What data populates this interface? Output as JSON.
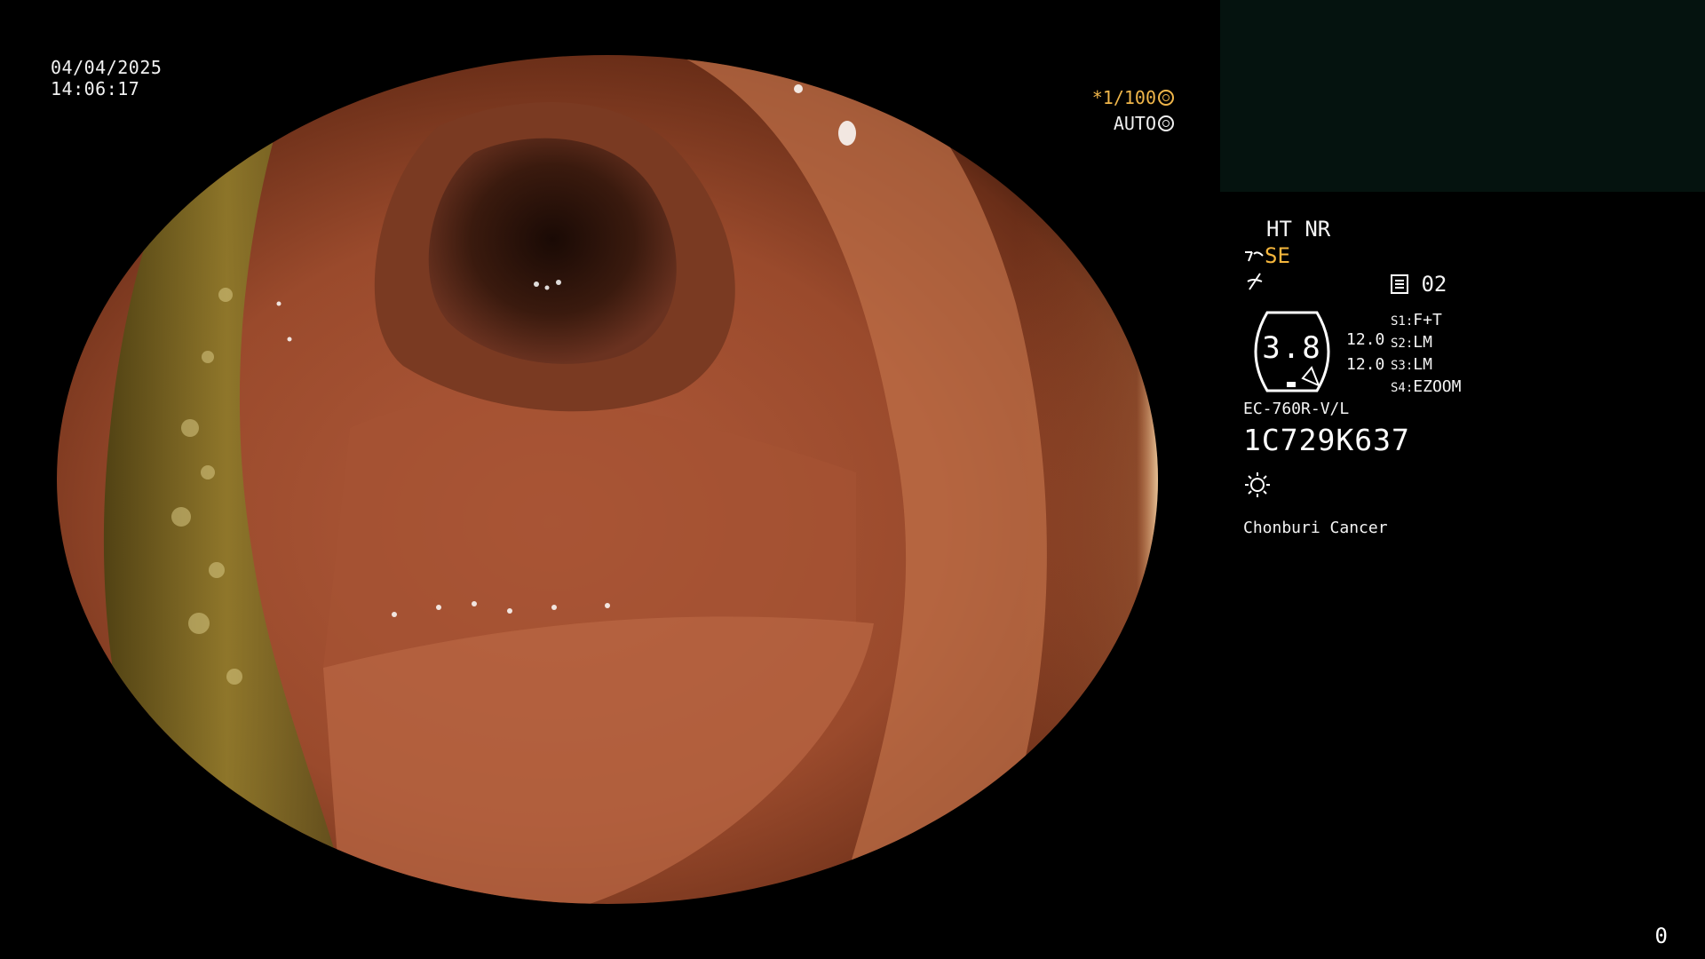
{
  "datetime": {
    "date": "04/04/2025",
    "time": "14:06:17"
  },
  "shutter": {
    "text": "*1/100",
    "icon": "shutter-icon",
    "color": "#f0b64a"
  },
  "iris": {
    "text": "AUTO",
    "icon": "iris-icon"
  },
  "panel": {
    "enhance": "HT NR",
    "structure_mode": "SE",
    "structure_icon": "structure-enhancement-icon",
    "color_icon": "color-mode-icon",
    "memory_icon": "memory-card-icon",
    "memory_count": "02",
    "gauge_value": "3.8",
    "gauge_left_top": "12.0",
    "gauge_left_bottom": "12.0",
    "switches": [
      {
        "key": "S1:",
        "value": "F+T"
      },
      {
        "key": "S2:",
        "value": "LM"
      },
      {
        "key": "S3:",
        "value": "LM"
      },
      {
        "key": "S4:",
        "value": "EZOOM"
      }
    ],
    "scope_model": "EC-760R-V/L",
    "serial": "1C729K637",
    "light_icon": "brightness-icon",
    "institution": "Chonburi Cancer"
  },
  "frame_counter": "0",
  "colors": {
    "accent_yellow": "#f5b63c",
    "background": "#000000",
    "thumbnail": "#05130f"
  }
}
